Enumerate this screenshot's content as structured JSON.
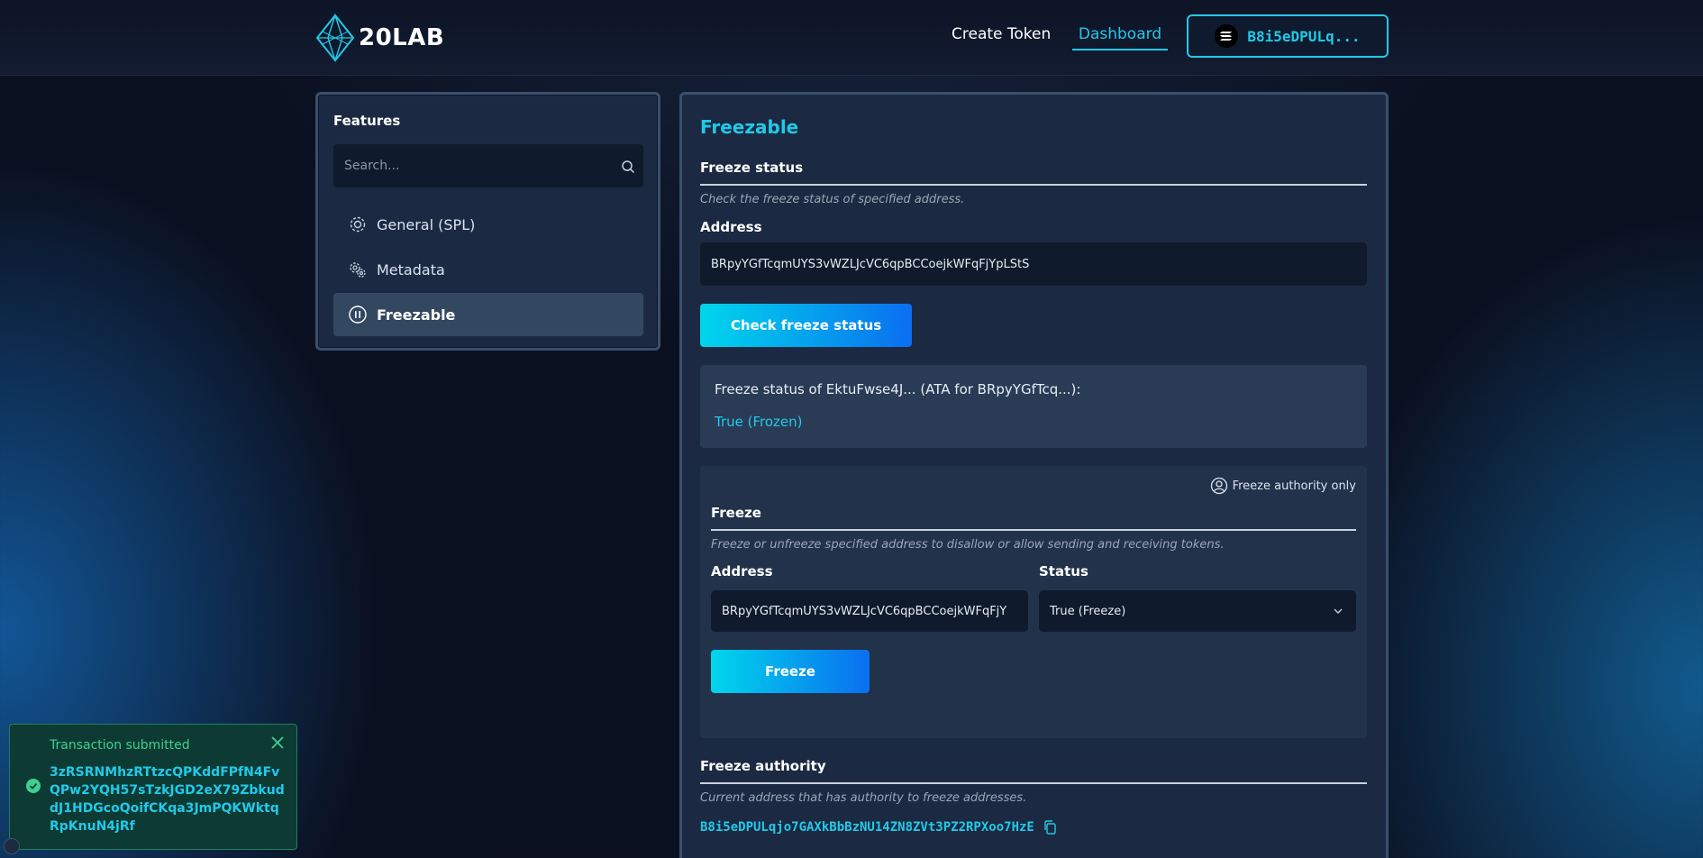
{
  "header": {
    "logo_text": "20LAB",
    "nav": [
      {
        "label": "Create Token"
      },
      {
        "label": "Dashboard"
      }
    ],
    "wallet_label": "B8i5eDPULq..."
  },
  "sidebar": {
    "title": "Features",
    "search_placeholder": "Search...",
    "items": [
      {
        "label": "General (SPL)",
        "icon": "gear-icon"
      },
      {
        "label": "Metadata",
        "icon": "gears-icon"
      },
      {
        "label": "Freezable",
        "icon": "pause-circle-icon",
        "active": true
      }
    ]
  },
  "main": {
    "title": "Freezable",
    "freeze_status": {
      "title": "Freeze status",
      "description": "Check the freeze status of specified address.",
      "address_label": "Address",
      "address_value": "BRpyYGfTcqmUYS3vWZLJcVC6qpBCCoejkWFqFjYpLStS",
      "button_label": "Check freeze status",
      "result_text": "Freeze status of EktuFwse4J... (ATA for BRpyYGfTcq...):",
      "result_value": "True (Frozen)"
    },
    "freeze": {
      "authority_badge": "Freeze authority only",
      "title": "Freeze",
      "description": "Freeze or unfreeze specified address to disallow or allow sending and receiving tokens.",
      "address_label": "Address",
      "address_value": "BRpyYGfTcqmUYS3vWZLJcVC6qpBCCoejkWFqFjY",
      "status_label": "Status",
      "status_value": "True (Freeze)",
      "button_label": "Freeze"
    },
    "freeze_authority": {
      "title": "Freeze authority",
      "description": "Current address that has authority to freeze addresses.",
      "address": "B8i5eDPULqjo7GAXkBbBzNU14ZN8ZVt3PZ2RPXoo7HzE"
    }
  },
  "toast": {
    "title": "Transaction submitted",
    "body": "3zRSRNMhzRTtzcQPKddFPfN4FvQPw2YQH57sTzkJGD2eX79ZbkuddJ1HDGcoQoifCKqa3JmPQKWktqRpKnuN4jRf"
  },
  "colors": {
    "accent": "#22c9e8",
    "panel": "#1b2a42",
    "toast_bg": "#0d3b34",
    "toast_title": "#3fd08f"
  }
}
